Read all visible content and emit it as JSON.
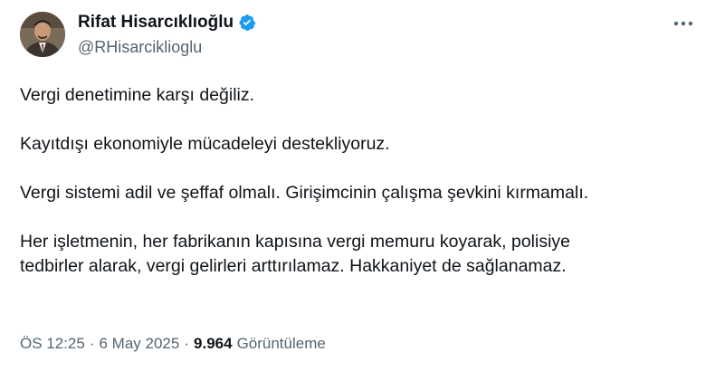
{
  "author": {
    "name": "Rifat Hisarcıklıoğlu",
    "handle": "@RHisarciklioglu",
    "verified_color": "#1d9bf0"
  },
  "menu": {
    "icon": "more-horizontal-icon"
  },
  "paragraphs": [
    "Vergi denetimine karşı değiliz.",
    "Kayıtdışı ekonomiyle mücadeleyi destekliyoruz.",
    "Vergi sistemi adil ve şeffaf olmalı. Girişimcinin çalışma şevkini kırmamalı.",
    "Her işletmenin, her fabrikanın kapısına vergi memuru koyarak, polisiye\ntedbirler alarak, vergi gelirleri arttırılamaz. Hakkaniyet de sağlanamaz."
  ],
  "meta": {
    "time": "ÖS 12:25",
    "separator": "·",
    "date": "6 May 2025",
    "views_count": "9.964",
    "views_label": "Görüntüleme"
  }
}
